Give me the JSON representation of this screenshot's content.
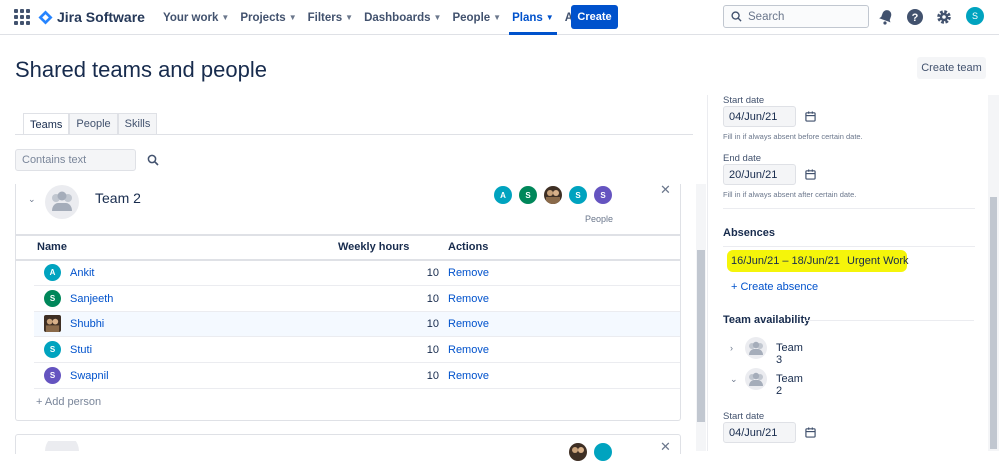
{
  "nav": {
    "product": "Jira Software",
    "menus": [
      {
        "label": "Your work",
        "active": false
      },
      {
        "label": "Projects",
        "active": false
      },
      {
        "label": "Filters",
        "active": false
      },
      {
        "label": "Dashboards",
        "active": false
      },
      {
        "label": "People",
        "active": false
      },
      {
        "label": "Plans",
        "active": true
      },
      {
        "label": "Apps",
        "active": false
      }
    ],
    "create_label": "Create",
    "search_placeholder": "Search",
    "user_initial": "S"
  },
  "page": {
    "title": "Shared teams and people",
    "create_team_label": "Create team",
    "tabs": [
      {
        "label": "Teams",
        "active": true
      },
      {
        "label": "People",
        "active": false
      },
      {
        "label": "Skills",
        "active": false
      }
    ],
    "filter_placeholder": "Contains text"
  },
  "team": {
    "name": "Team 2",
    "people_label": "People",
    "avatars": [
      {
        "initial": "A",
        "color": "#00a3bf"
      },
      {
        "initial": "S",
        "color": "#00875a"
      },
      {
        "initial": "",
        "color": "#5e4b3c",
        "photo": true
      },
      {
        "initial": "S",
        "color": "#00a3bf"
      },
      {
        "initial": "S",
        "color": "#6554c0"
      }
    ],
    "columns": {
      "name": "Name",
      "hours": "Weekly hours",
      "actions": "Actions"
    },
    "members": [
      {
        "initial": "A",
        "name": "Ankit",
        "hours": "10",
        "action": "Remove",
        "color": "#00a3bf",
        "photo": false
      },
      {
        "initial": "S",
        "name": "Sanjeeth",
        "hours": "10",
        "action": "Remove",
        "color": "#00875a",
        "photo": false
      },
      {
        "initial": "",
        "name": "Shubhi",
        "hours": "10",
        "action": "Remove",
        "color": "#5e4b3c",
        "photo": true
      },
      {
        "initial": "S",
        "name": "Stuti",
        "hours": "10",
        "action": "Remove",
        "color": "#00a3bf",
        "photo": false
      },
      {
        "initial": "S",
        "name": "Swapnil",
        "hours": "10",
        "action": "Remove",
        "color": "#6554c0",
        "photo": false
      }
    ],
    "add_person_label": "+ Add person"
  },
  "right": {
    "start_label": "Start date",
    "start_value": "04/Jun/21",
    "start_hint": "Fill in if always absent before certain date.",
    "end_label": "End date",
    "end_value": "20/Jun/21",
    "end_hint": "Fill in if always absent after certain date.",
    "absences_title": "Absences",
    "absence": {
      "dates": "16/Jun/21 – 18/Jun/21",
      "reason": "Urgent Work",
      "highlight": "#f5f50a"
    },
    "create_absence_label": "+ Create absence",
    "availability_title": "Team availability",
    "availability_teams": [
      {
        "name": "Team 3",
        "expanded": false
      },
      {
        "name": "Team 2",
        "expanded": true
      }
    ],
    "start_label_2": "Start date",
    "start_value_2": "04/Jun/21"
  },
  "colors": {
    "brand": "#0052cc",
    "link": "#0052cc",
    "highlight": "#f5f50a"
  }
}
